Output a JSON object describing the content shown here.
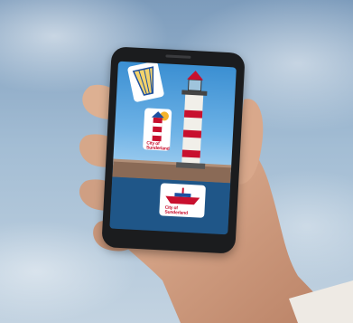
{
  "scene": {
    "description_icons": [
      "hand",
      "smartphone",
      "lighthouse",
      "fish-and-chips-sticker",
      "lighthouse-sticker",
      "boat-sticker"
    ],
    "colors": {
      "sky": "#9bb6cf",
      "phone": "#1b1c1e",
      "brand_red": "#c8102e",
      "sea": "#1e4f7d"
    }
  },
  "stickers": {
    "lighthouse_sticker_text_1": "City of",
    "lighthouse_sticker_text_2": "Sunderland",
    "boat_sticker_text_1": "City of",
    "boat_sticker_text_2": "Sunderland"
  }
}
